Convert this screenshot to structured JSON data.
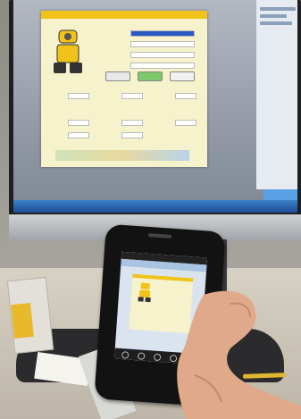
{
  "photo": {
    "subject": "smartphone-remote-control-of-desktop-app",
    "colors": {
      "wall": "#9a9890",
      "app_background": "#f6f2cc",
      "app_titlebar": "#f0c21a",
      "taskbar": "#2563a8",
      "phone_body": "#121212"
    }
  },
  "icons": [
    "robot-device-icon",
    "start-button-icon",
    "stop-button-icon",
    "phone-nav-icons"
  ]
}
